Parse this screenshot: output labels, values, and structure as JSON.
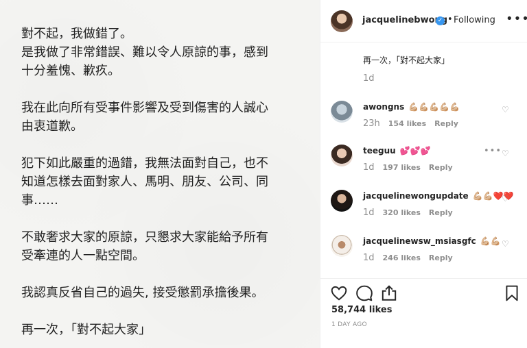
{
  "post_text": {
    "paragraphs": [
      [
        "對不起，我做錯了。",
        "是我做了非常錯誤、難以令人原諒的事，感到",
        "十分羞愧、歉疚。"
      ],
      [
        "我在此向所有受事件影響及受到傷害的人誠心",
        "由衷道歉。"
      ],
      [
        "犯下如此嚴重的過錯，我無法面對自己，也不",
        "知道怎樣去面對家人、馬明、朋友、公司、同",
        "事……"
      ],
      [
        "不敢奢求大家的原諒，只懇求大家能給予所有",
        "受牽連的人一點空間。"
      ],
      [
        "我認真反省自己的過失, 接受懲罰承擔後果。"
      ],
      [
        "再一次，「對不起大家」"
      ]
    ]
  },
  "header": {
    "username": "jacquelinebwong",
    "verified_glyph": "✓",
    "separator": "•",
    "follow_status": "Following",
    "more_glyph": "•••"
  },
  "caption": {
    "text": "再一次，「對不起大家」",
    "time": "1d"
  },
  "comments": [
    {
      "username": "awongns",
      "emoji": "💪🏼💪🏼💪🏼💪🏼💪🏼",
      "time": "23h",
      "likes": "154 likes",
      "reply": "Reply",
      "show_more": false
    },
    {
      "username": "teeguu",
      "emoji": "💕💕💕",
      "time": "1d",
      "likes": "197 likes",
      "reply": "Reply",
      "show_more": true
    },
    {
      "username": "jacquelinewongupdate",
      "emoji": "💪🏼💪🏼❤️❤️",
      "time": "1d",
      "likes": "320 likes",
      "reply": "Reply",
      "show_more": false
    },
    {
      "username": "jacquelinewsw_msiasgfc",
      "emoji": "💪🏼💪🏼",
      "time": "1d",
      "likes": "246 likes",
      "reply": "Reply",
      "show_more": false
    }
  ],
  "actions": {
    "likes": "58,744 likes",
    "date": "1 DAY AGO"
  },
  "icons": {
    "heart": "heart-icon",
    "comment": "comment-icon",
    "share": "share-icon",
    "bookmark": "bookmark-icon"
  },
  "colors": {
    "verified": "#3897f0",
    "muted": "#8e8e8e",
    "text": "#262626"
  }
}
